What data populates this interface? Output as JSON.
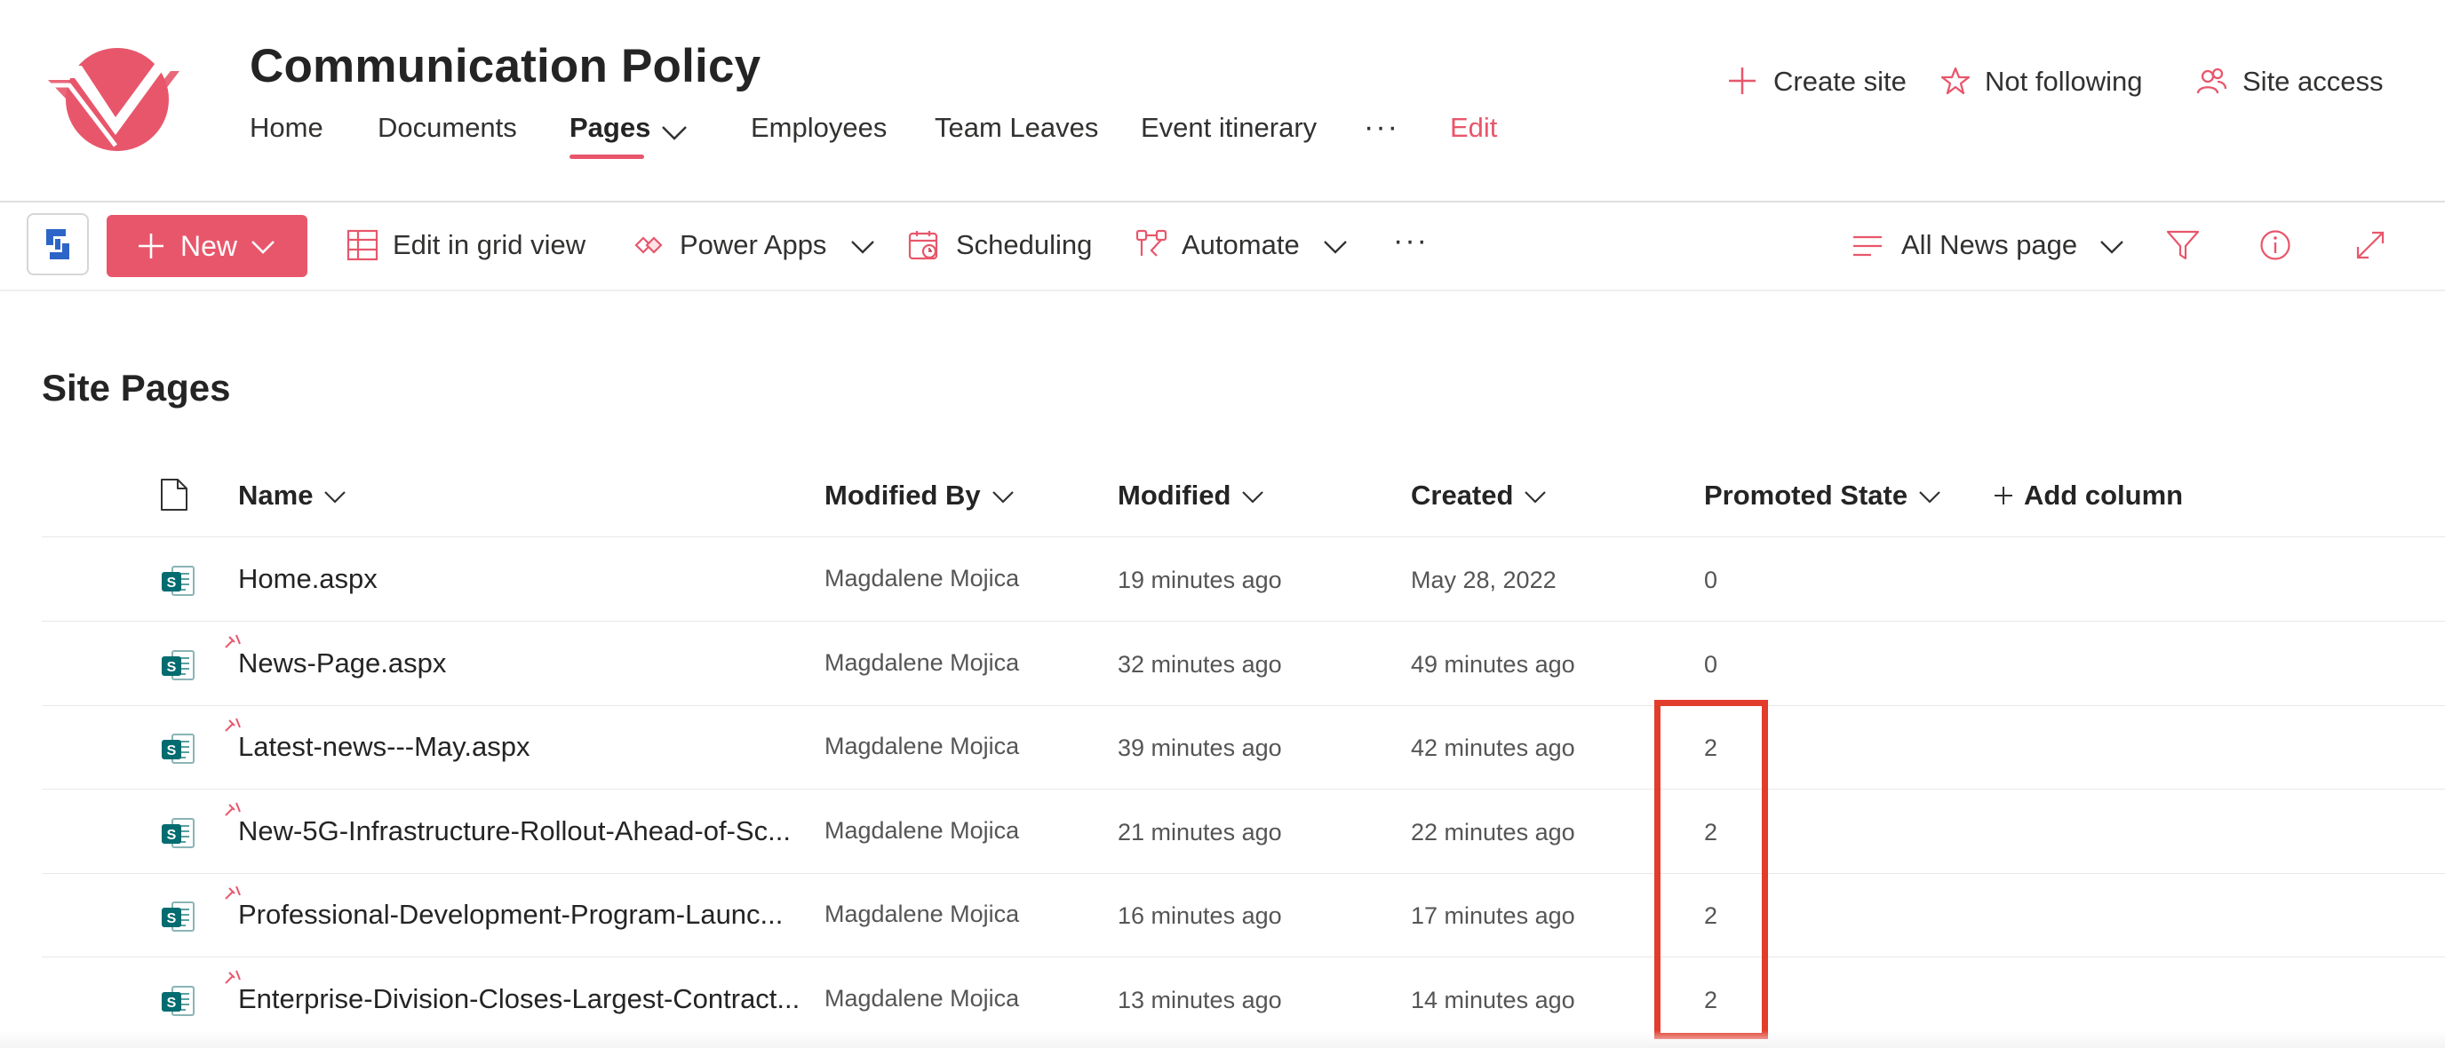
{
  "site": {
    "title": "Communication Policy",
    "nav": {
      "items": [
        "Home",
        "Documents",
        "Pages",
        "Employees",
        "Team Leaves",
        "Event itinerary"
      ],
      "more": "···",
      "edit": "Edit",
      "active": "Pages"
    },
    "actions": {
      "create_site": "Create site",
      "follow": "Not following",
      "access": "Site access"
    }
  },
  "commandbar": {
    "new_label": "New",
    "edit_grid": "Edit in grid view",
    "power_apps": "Power Apps",
    "scheduling": "Scheduling",
    "automate": "Automate",
    "more": "···",
    "view_label": "All News page"
  },
  "list": {
    "title": "Site Pages",
    "columns": {
      "name": "Name",
      "modified_by": "Modified By",
      "modified": "Modified",
      "created": "Created",
      "promoted_state": "Promoted State",
      "add_column": "Add column"
    },
    "rows": [
      {
        "name": "Home.aspx",
        "modified_by": "Magdalene Mojica",
        "modified": "19 minutes ago",
        "created": "May 28, 2022",
        "promoted_state": "0",
        "is_new": false
      },
      {
        "name": "News-Page.aspx",
        "modified_by": "Magdalene Mojica",
        "modified": "32 minutes ago",
        "created": "49 minutes ago",
        "promoted_state": "0",
        "is_new": true
      },
      {
        "name": "Latest-news---May.aspx",
        "modified_by": "Magdalene Mojica",
        "modified": "39 minutes ago",
        "created": "42 minutes ago",
        "promoted_state": "2",
        "is_new": true
      },
      {
        "name": "New-5G-Infrastructure-Rollout-Ahead-of-Sc...",
        "modified_by": "Magdalene Mojica",
        "modified": "21 minutes ago",
        "created": "22 minutes ago",
        "promoted_state": "2",
        "is_new": true
      },
      {
        "name": "Professional-Development-Program-Launc...",
        "modified_by": "Magdalene Mojica",
        "modified": "16 minutes ago",
        "created": "17 minutes ago",
        "promoted_state": "2",
        "is_new": true
      },
      {
        "name": "Enterprise-Division-Closes-Largest-Contract...",
        "modified_by": "Magdalene Mojica",
        "modified": "13 minutes ago",
        "created": "14 minutes ago",
        "promoted_state": "2",
        "is_new": true
      }
    ]
  },
  "colors": {
    "accent": "#e8566b",
    "highlight": "#e23c2c",
    "text": "#242424",
    "sharepoint_icon": "#036c70"
  },
  "icons": {
    "logo": "site-logo",
    "create": "plus-icon",
    "follow": "star-icon",
    "access": "people-icon",
    "grid": "grid-icon",
    "power_apps": "power-apps-icon",
    "scheduling": "calendar-icon",
    "automate": "automate-icon",
    "view": "list-lines-icon",
    "filter": "filter-icon",
    "info": "info-icon",
    "expand": "expand-icon",
    "file": "document-icon",
    "page": "sharepoint-page-icon"
  }
}
